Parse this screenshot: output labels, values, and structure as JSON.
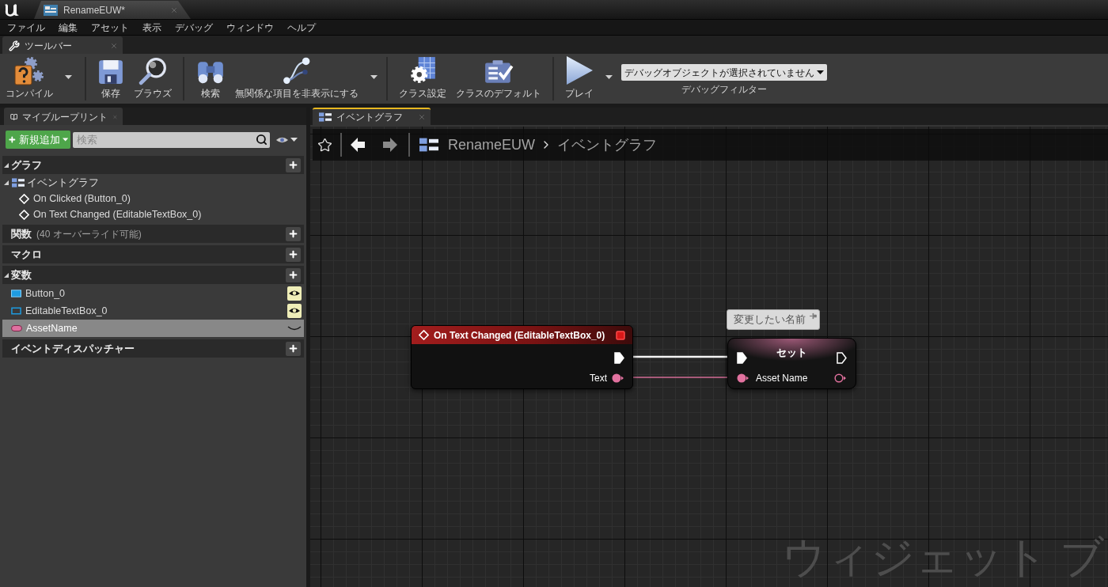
{
  "title_bar": {
    "document_tab": {
      "title": "RenameEUW*"
    }
  },
  "menu_bar": [
    "ファイル",
    "編集",
    "アセット",
    "表示",
    "デバッグ",
    "ウィンドウ",
    "ヘルプ"
  ],
  "toolbar_tab": {
    "title": "ツールバー",
    "active": false
  },
  "toolbar": {
    "groups": [
      [
        {
          "label": "コンパイル",
          "menu_caret": true
        }
      ],
      [
        {
          "label": "保存",
          "menu_caret": false
        },
        {
          "label": "ブラウズ",
          "menu_caret": false
        }
      ],
      [
        {
          "label": "検索",
          "menu_caret": false
        },
        {
          "label": "無関係な項目を非表示にする",
          "menu_caret": true
        }
      ],
      [
        {
          "label": "クラス設定",
          "menu_caret": false
        },
        {
          "label": "クラスのデフォルト",
          "menu_caret": false
        }
      ],
      [
        {
          "label": "プレイ",
          "menu_caret": true
        }
      ]
    ],
    "debug_filter": {
      "value": "デバッグオブジェクトが選択されていません",
      "label": "デバッグフィルター"
    }
  },
  "my_blueprint": {
    "tab": {
      "title": "マイブループリント",
      "active": false
    },
    "add_button": {
      "label": "新規追加"
    },
    "search": {
      "placeholder": "検索"
    },
    "sections": [
      {
        "title": "グラフ",
        "expanded": true,
        "items": [
          {
            "label": "イベントグラフ",
            "kind": "graph",
            "expanded": true,
            "selected": false,
            "children": [
              {
                "label": "On Clicked (Button_0)",
                "kind": "event",
                "selected": false
              },
              {
                "label": "On Text Changed (EditableTextBox_0)",
                "kind": "event",
                "selected": false
              }
            ]
          }
        ]
      },
      {
        "title": "関数",
        "note": "(40 オーバーライド可能)",
        "expanded": false
      },
      {
        "title": "マクロ",
        "expanded": false
      },
      {
        "title": "変数",
        "expanded": true,
        "items": [
          {
            "label": "Button_0",
            "kind": "button",
            "public": true,
            "selected": false
          },
          {
            "label": "EditableTextBox_0",
            "kind": "textbox",
            "public": true,
            "selected": false
          },
          {
            "label": "AssetName",
            "kind": "text",
            "public": false,
            "selected": true
          }
        ]
      },
      {
        "title": "イベントディスパッチャー",
        "expanded": false
      }
    ]
  },
  "graph_editor": {
    "tab": {
      "title": "イベントグラフ",
      "active": true
    },
    "breadcrumb": [
      "RenameEUW",
      "イベントグラフ"
    ],
    "nodes": [
      {
        "kind": "event",
        "title": "On Text Changed (EditableTextBox_0)",
        "outputs": [
          {
            "kind": "exec",
            "connected": true
          },
          {
            "kind": "data",
            "label": "Text",
            "connected": true
          }
        ]
      },
      {
        "kind": "set",
        "title": "セット",
        "comment": "変更したい名前",
        "inputs": [
          {
            "kind": "exec",
            "connected": true
          },
          {
            "kind": "data",
            "label": "Asset Name",
            "connected": true
          }
        ],
        "outputs": [
          {
            "kind": "exec",
            "connected": false
          },
          {
            "kind": "data",
            "connected": false
          }
        ]
      }
    ],
    "corner_label": "ウィジェット ブ"
  }
}
